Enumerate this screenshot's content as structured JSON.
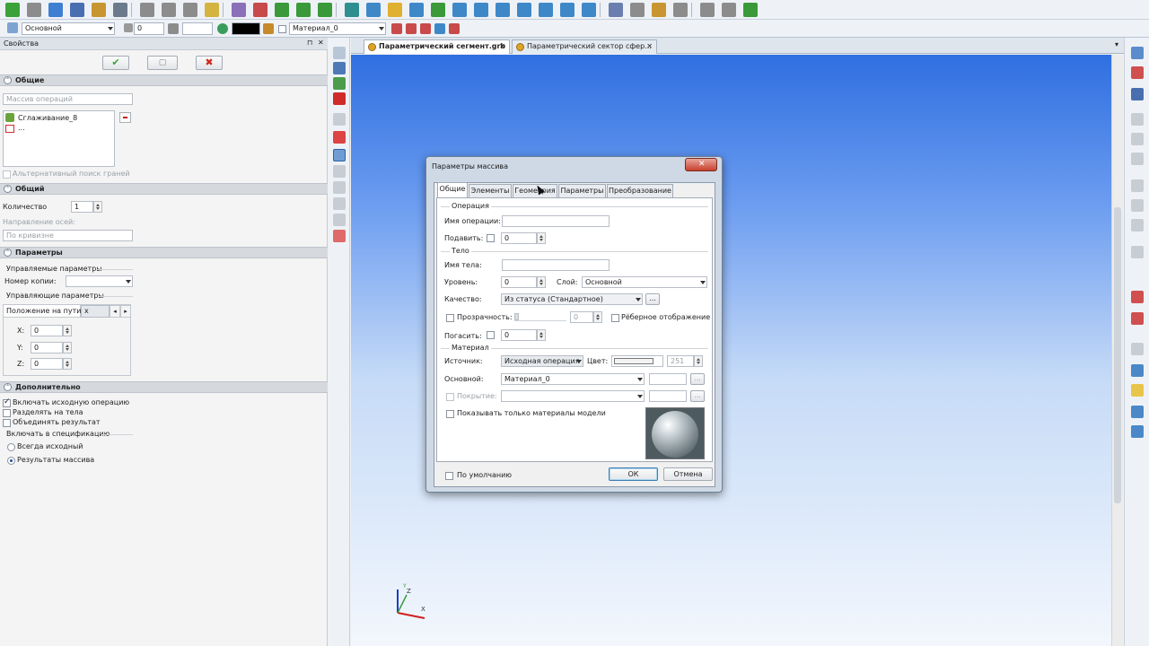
{
  "toolbar": {
    "layer_value": "Основной",
    "level_value": "0",
    "material_value": "Материал_0",
    "color_swatch": "#000000"
  },
  "props": {
    "title": "Свойства",
    "pin": "⊓",
    "close": "✕",
    "sec_common": "Общие",
    "array_type": "Массив операций",
    "list_item_1": "Сглаживание_8",
    "list_item_2": "...",
    "alt_face_search": "Альтернативный поиск граней",
    "sec_general": "Общий",
    "count_label": "Количество",
    "count_value": "1",
    "axis_dir_label": "Направление осей:",
    "axis_dir_value": "По кривизне",
    "sec_params": "Параметры",
    "managed_params": "Управляемые параметры",
    "copy_num_label": "Номер копии:",
    "managing_params": "Управляющие параметры",
    "path_pos_label": "Положение на пути",
    "path_pos_value": "x",
    "x_label": "X:",
    "x_value": "0",
    "y_label": "Y:",
    "y_value": "0",
    "z_label": "Z:",
    "z_value": "0",
    "sec_extra": "Дополнительно",
    "include_source": "Включать исходную операцию",
    "split_bodies": "Разделять на тела",
    "merge_result": "Объединять результат",
    "include_spec": "Включать в спецификацию",
    "always_source": "Всегда исходный",
    "array_results": "Результаты массива"
  },
  "tabs": [
    {
      "label": "Параметрический сегмент.grb",
      "close": "✕"
    },
    {
      "label": "Параметрический сектор сфер...",
      "close": "✕"
    }
  ],
  "tabs_menu": "▾",
  "dialog": {
    "title": "Параметры массива",
    "tabs": [
      "Общие",
      "Элементы",
      "Геометрия",
      "Параметры",
      "Преобразование"
    ],
    "grp_operation": "Операция",
    "op_name_label": "Имя операции:",
    "suppress_label": "Подавить:",
    "suppress_value": "0",
    "grp_body": "Тело",
    "body_name_label": "Имя тела:",
    "level_label": "Уровень:",
    "level_value": "0",
    "layer_label": "Слой:",
    "layer_value": "Основной",
    "quality_label": "Качество:",
    "quality_value": "Из статуса (Стандартное)",
    "quality_more": "...",
    "transparency_label": "Прозрачность:",
    "transparency_value": "0",
    "edge_display": "Рёберное отображение",
    "extinguish_label": "Погасить:",
    "extinguish_value": "0",
    "grp_material": "Материал",
    "source_label": "Источник:",
    "source_value": "Исходная операция",
    "color_label": "Цвет:",
    "color_value": "251",
    "main_label": "Основной:",
    "main_value": "Материал_0",
    "main_more": "...",
    "coating_label": "Покрытие:",
    "coating_more": "...",
    "model_materials_only": "Показывать только материалы модели",
    "default_label": "По умолчанию",
    "ok": "ОК",
    "cancel": "Отмена"
  },
  "axes": {
    "z": "Z",
    "x": "X",
    "y": "Y"
  }
}
